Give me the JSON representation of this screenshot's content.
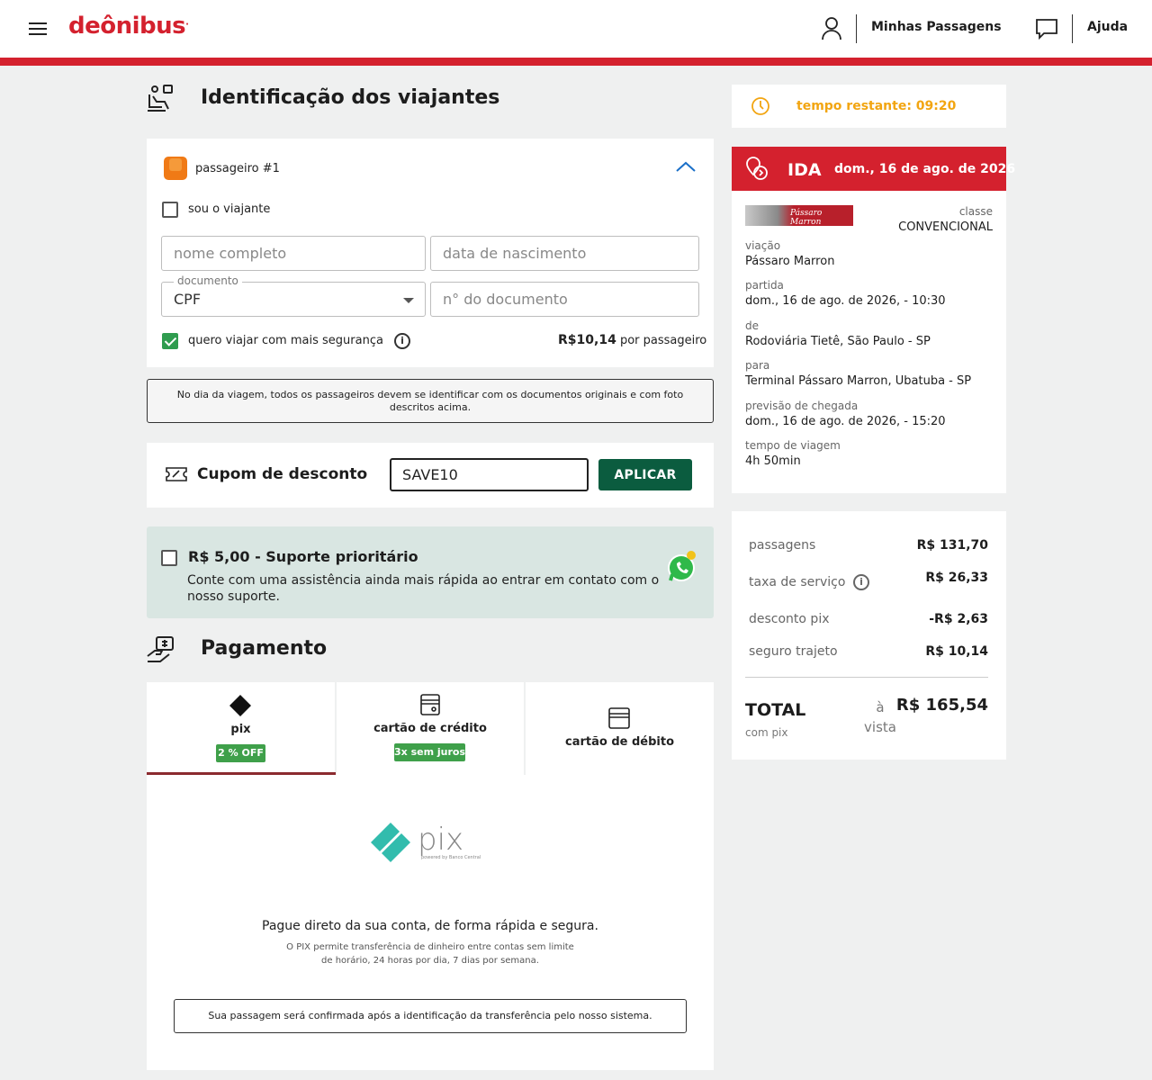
{
  "header": {
    "logo": "deônibus",
    "my_tickets": "Minhas Passagens",
    "help": "Ajuda"
  },
  "travelers": {
    "title": "Identificação dos viajantes",
    "passenger_label": "passageiro #1",
    "i_am_traveler": "sou o viajante",
    "full_name_placeholder": "nome completo",
    "birth_date_placeholder": "data de nascimento",
    "document_legend": "documento",
    "document_value": "CPF",
    "document_number_placeholder": "n° do documento",
    "safety_label": "quero viajar com mais segurança",
    "safety_price": "R$10,14",
    "safety_price_suffix": "por passageiro",
    "notice": "No dia da viagem, todos os passageiros devem se identificar com os documentos originais e com foto descritos acima."
  },
  "coupon": {
    "title": "Cupom de desconto",
    "value": "SAVE10",
    "apply": "APLICAR"
  },
  "priority_support": {
    "title": "R$ 5,00 - Suporte prioritário",
    "description": "Conte com uma assistência ainda mais rápida ao entrar em contato com o nosso suporte."
  },
  "payment": {
    "title": "Pagamento",
    "tabs": [
      {
        "label": "pix",
        "badge": "2 % OFF"
      },
      {
        "label": "cartão de crédito",
        "badge": "3x sem juros"
      },
      {
        "label": "cartão de débito",
        "badge": ""
      }
    ],
    "pix_logo_text": "pix",
    "pix_powered": "powered by Banco Central",
    "pix_main": "Pague direto da sua conta, de forma rápida e segura.",
    "pix_sub_1": "O PIX permite transferência de dinheiro entre contas sem limite",
    "pix_sub_2": "de horário, 24 horas por dia, 7 dias por semana.",
    "pix_confirm": "Sua passagem será confirmada após a identificação da transferência pelo nosso sistema."
  },
  "timer": {
    "text": "tempo restante: 09:20"
  },
  "trip": {
    "direction": "IDA",
    "date": "dom., 16 de ago. de 2026",
    "carrier_logo_text": "Pássaro Marron",
    "class_label": "classe",
    "class_value": "CONVENCIONAL",
    "company_label": "viação",
    "company_value": "Pássaro Marron",
    "departure_label": "partida",
    "departure_value": "dom., 16 de ago. de 2026, - 10:30",
    "from_label": "de",
    "from_value": "Rodoviária Tietê, São Paulo - SP",
    "to_label": "para",
    "to_value": "Terminal Pássaro Marron, Ubatuba - SP",
    "arrival_label": "previsão de chegada",
    "arrival_value": "dom., 16 de ago. de 2026, - 15:20",
    "duration_label": "tempo de viagem",
    "duration_value": "4h 50min"
  },
  "summary": {
    "tickets_label": "passagens",
    "tickets_value": "R$ 131,70",
    "fee_label": "taxa de serviço",
    "fee_value": "R$ 26,33",
    "pix_discount_label": "desconto pix",
    "pix_discount_value": "-R$ 2,63",
    "insurance_label": "seguro trajeto",
    "insurance_value": "R$ 10,14",
    "total_label": "TOTAL",
    "total_sub": "com pix",
    "cash_line1": "à",
    "cash_line2": "vista",
    "total_value": "R$ 165,54"
  },
  "colors": {
    "brand_red": "#d4212e",
    "apply_green": "#0b5c3f",
    "badge_green": "#3fa04a",
    "timer_orange": "#f2a511",
    "priority_bg": "#d9e6e2"
  }
}
